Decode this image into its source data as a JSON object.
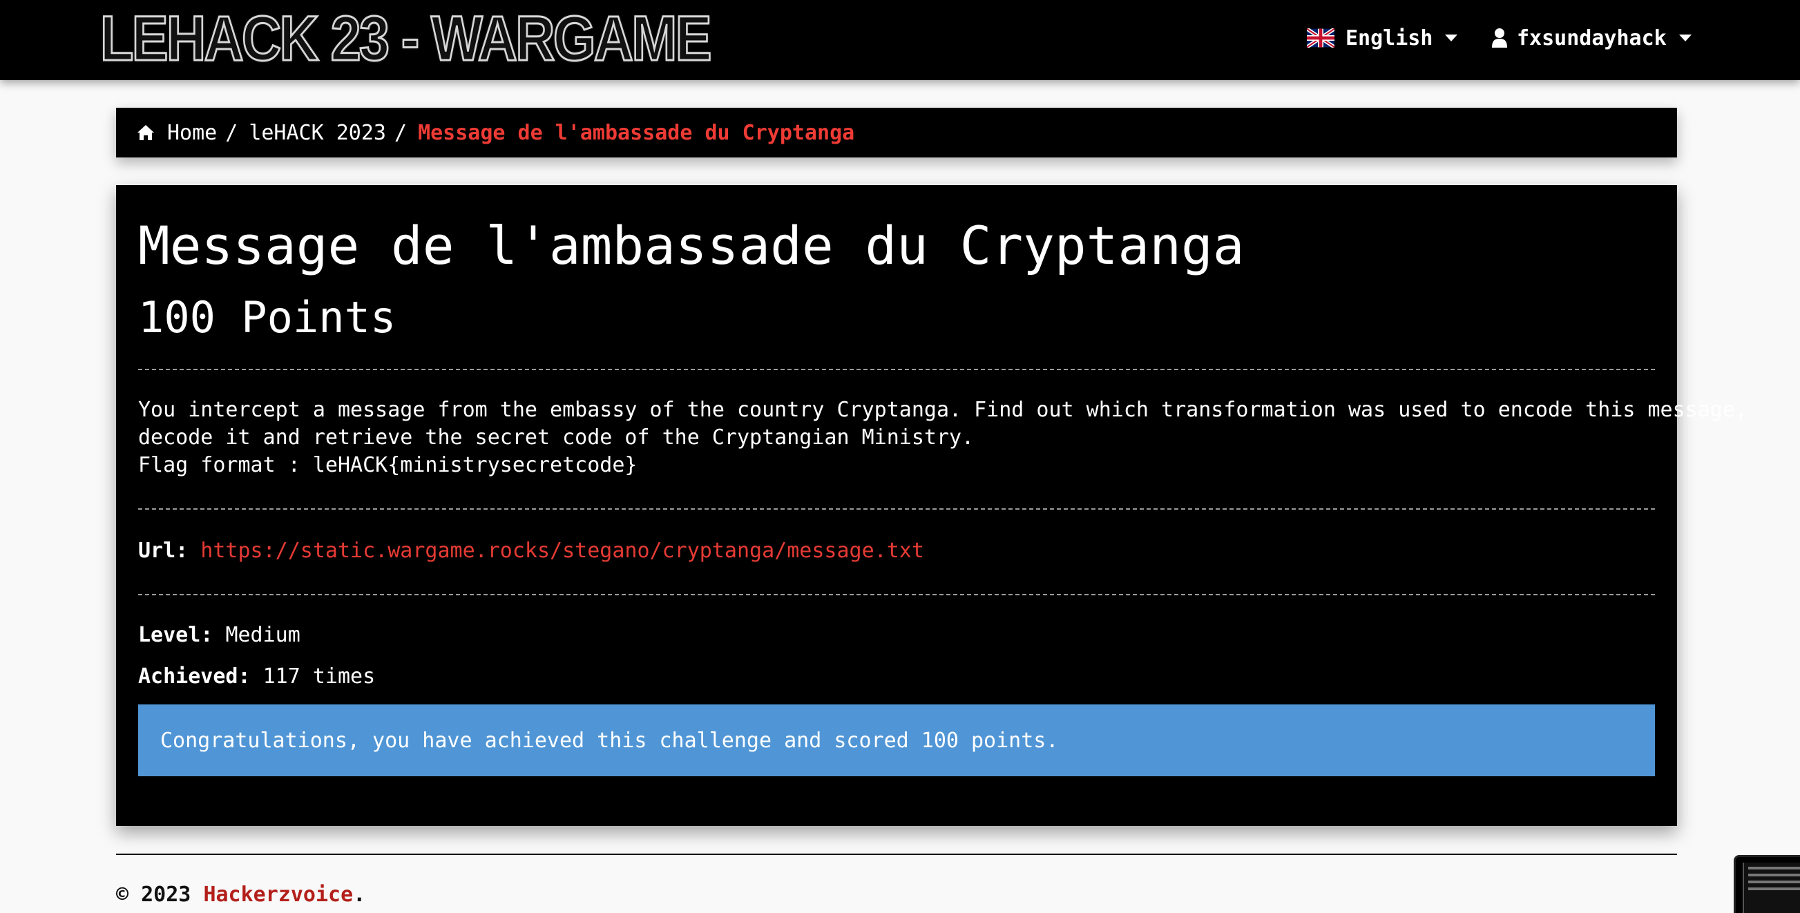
{
  "navbar": {
    "brand": "LEHACK 23 - WARGAME",
    "language": "English",
    "username": "fxsundayhack"
  },
  "breadcrumb": {
    "home": "Home",
    "sep": "/",
    "event": "leHACK 2023",
    "current": "Message de l'ambassade du Cryptanga"
  },
  "challenge": {
    "title": "Message de l'ambassade du Cryptanga",
    "points": "100 Points",
    "description_line1": "You intercept a message from the embassy of the country Cryptanga. Find out which transformation was used to encode this message,",
    "description_line2": "decode it and retrieve the secret code of the Cryptangian Ministry.",
    "description_line3": "Flag format : leHACK{ministrysecretcode}",
    "url_label": "Url:",
    "url": "https://static.wargame.rocks/stegano/cryptanga/message.txt",
    "level_label": "Level:",
    "level": "Medium",
    "achieved_label": "Achieved:",
    "achieved": "117 times",
    "success_message": "Congratulations, you have achieved this challenge and scored 100 points."
  },
  "footer": {
    "copyright": "© 2023",
    "org": "Hackerzvoice",
    "suffix": "."
  },
  "colors": {
    "accent_red": "#ef3b35",
    "link_red": "#e53a34",
    "alert_blue": "#5096d6",
    "footer_link": "#b31f1a"
  },
  "icons": {
    "language": "uk-flag-icon",
    "user": "user-icon",
    "caret": "caret-down-icon",
    "home": "home-icon"
  }
}
